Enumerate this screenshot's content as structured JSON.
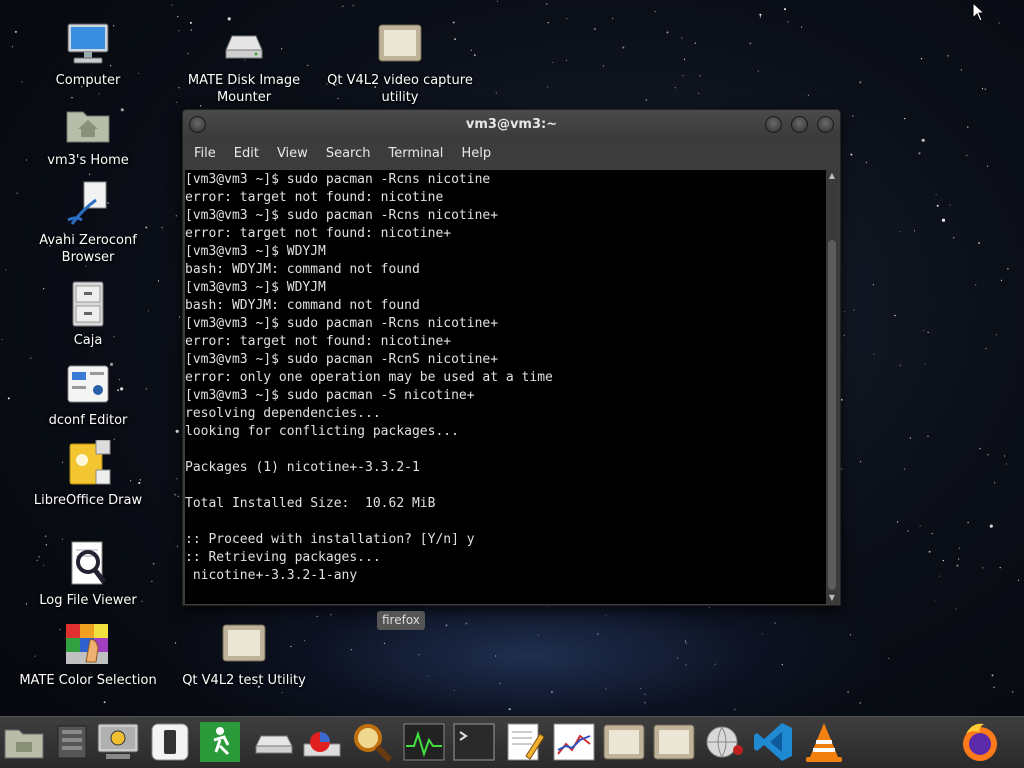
{
  "desktop": {
    "icons": [
      {
        "label": "Computer",
        "icon": "computer-icon"
      },
      {
        "label": "vm3's Home",
        "icon": "home-folder-icon"
      },
      {
        "label": "Avahi Zeroconf Browser",
        "icon": "avahi-browser-icon"
      },
      {
        "label": "Caja",
        "icon": "file-cabinet-icon"
      },
      {
        "label": "dconf Editor",
        "icon": "dconf-editor-icon"
      },
      {
        "label": "LibreOffice Draw",
        "icon": "libreoffice-draw-icon"
      },
      {
        "label": "Log File Viewer",
        "icon": "log-viewer-icon"
      },
      {
        "label": "MATE Color Selection",
        "icon": "color-selection-icon"
      },
      {
        "label": "MATE Disk Image Mounter",
        "icon": "disk-mounter-icon"
      },
      {
        "label": "Qt V4L2 video capture utility",
        "icon": "video-capture-icon"
      },
      {
        "label": "Qt V4L2 test Utility",
        "icon": "test-utility-icon"
      }
    ]
  },
  "terminal": {
    "title": "vm3@vm3:~",
    "menu": [
      "File",
      "Edit",
      "View",
      "Search",
      "Terminal",
      "Help"
    ],
    "lines": [
      "[vm3@vm3 ~]$ sudo pacman -Rcns nicotine",
      "error: target not found: nicotine",
      "[vm3@vm3 ~]$ sudo pacman -Rcns nicotine+",
      "error: target not found: nicotine+",
      "[vm3@vm3 ~]$ WDYJM",
      "bash: WDYJM: command not found",
      "[vm3@vm3 ~]$ WDYJM",
      "bash: WDYJM: command not found",
      "[vm3@vm3 ~]$ sudo pacman -Rcns nicotine+",
      "error: target not found: nicotine+",
      "[vm3@vm3 ~]$ sudo pacman -RcnS nicotine+",
      "error: only one operation may be used at a time",
      "[vm3@vm3 ~]$ sudo pacman -S nicotine+",
      "resolving dependencies...",
      "looking for conflicting packages...",
      "",
      "Packages (1) nicotine+-3.3.2-1",
      "",
      "Total Installed Size:  10.62 MiB",
      "",
      ":: Proceed with installation? [Y/n] y",
      ":: Retrieving packages...",
      " nicotine+-3.3.2-1-any"
    ]
  },
  "tooltip": {
    "text": "firefox"
  },
  "taskbar": {
    "items": [
      "file-manager-icon",
      "network-icon",
      "monitor-icon",
      "mobile-device-icon",
      "exit-icon",
      "drive-icon",
      "disk-usage-icon",
      "search-magnifier-icon",
      "system-monitor-icon",
      "terminal-icon",
      "text-editor-icon",
      "chart-icon",
      "video-capture-icon",
      "test-utility-icon",
      "network-globe-icon",
      "vscode-icon",
      "vlc-icon",
      "firefox-icon"
    ]
  },
  "colors": {
    "terminal_bg": "#000000",
    "window_chrome": "#3c3c3c",
    "panel": "#333333"
  }
}
